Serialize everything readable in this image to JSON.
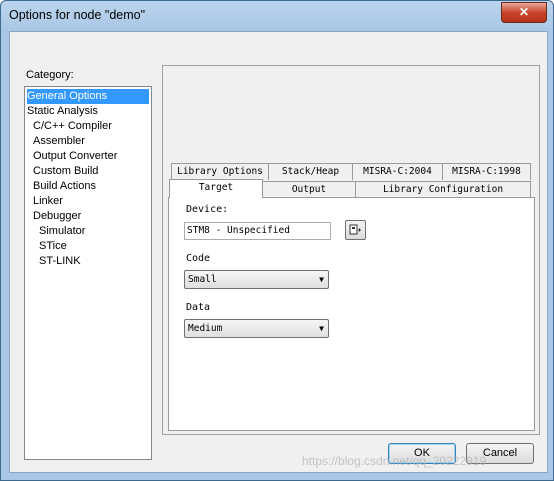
{
  "window": {
    "title": "Options for node \"demo\"",
    "close_glyph": "✕"
  },
  "category": {
    "label": "Category:",
    "items": [
      {
        "label": "General Options"
      },
      {
        "label": "Static Analysis"
      },
      {
        "label": "C/C++ Compiler"
      },
      {
        "label": "Assembler"
      },
      {
        "label": "Output Converter"
      },
      {
        "label": "Custom Build"
      },
      {
        "label": "Build Actions"
      },
      {
        "label": "Linker"
      },
      {
        "label": "Debugger"
      },
      {
        "label": "Simulator"
      },
      {
        "label": "STice"
      },
      {
        "label": "ST-LINK"
      }
    ],
    "selected": "General Options"
  },
  "tabs": {
    "row_back": [
      "Library Options",
      "Stack/Heap",
      "MISRA-C:2004",
      "MISRA-C:1998"
    ],
    "row_front": [
      "Target",
      "Output",
      "Library Configuration"
    ],
    "active": "Target"
  },
  "target": {
    "device_label": "Device:",
    "device_value": "STM8 - Unspecified",
    "code_label": "Code",
    "code_value": "Small",
    "data_label": "Data",
    "data_value": "Medium"
  },
  "buttons": {
    "ok": "OK",
    "cancel": "Cancel"
  },
  "watermark": "https://blog.csdn.net/qq_20222919",
  "icons": {
    "close": "close-icon",
    "device_picker": "device-picker-icon",
    "dropdown": "chevron-down-icon"
  }
}
